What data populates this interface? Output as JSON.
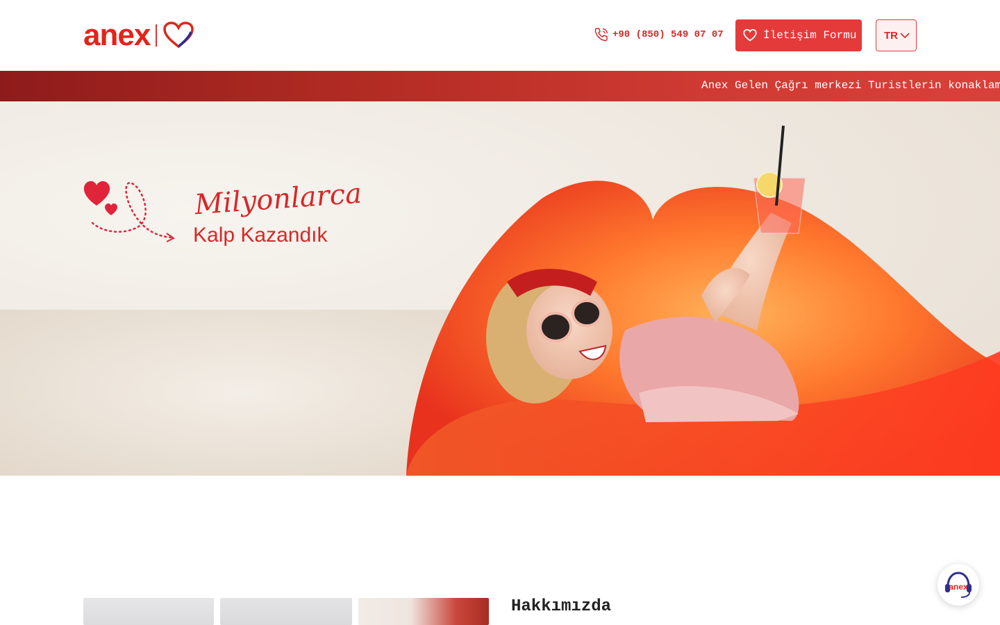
{
  "brand": {
    "logo_text": "anex",
    "accent": "#e1251b",
    "accent_dark": "#8e1b1b"
  },
  "header": {
    "phone": "+90 (850) 549 07 07",
    "contact_button": "İletişim Formu",
    "language": "TR"
  },
  "ticker": {
    "text": "Anex Gelen Çağrı merkezi Turistlerin konaklam"
  },
  "hero": {
    "title_line1": "Milyonlarca",
    "title_line2": "Kalp Kazandık"
  },
  "about": {
    "title": "Hakkımızda"
  },
  "float_button": {
    "label": "anex"
  },
  "icons": {
    "phone": "phone-icon",
    "heart": "heart-icon",
    "chevron": "chevron-down-icon",
    "support": "headset-icon"
  }
}
